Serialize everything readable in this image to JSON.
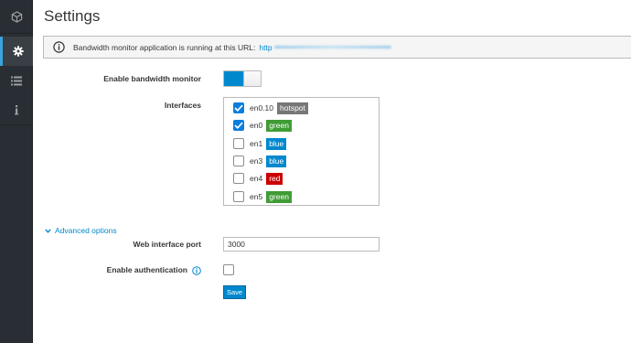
{
  "page": {
    "title": "Settings"
  },
  "sidebar": {
    "items": [
      {
        "icon": "cube-icon",
        "active": false
      },
      {
        "icon": "gear-icon",
        "active": true
      },
      {
        "icon": "list-icon",
        "active": false
      },
      {
        "icon": "info-icon",
        "active": false
      }
    ]
  },
  "alert": {
    "icon": "info-circle-icon",
    "message": "Bandwidth monitor application is running at this URL:",
    "url_prefix": "http"
  },
  "form": {
    "bandwidth_label": "Enable bandwidth monitor",
    "bandwidth_enabled": true,
    "interfaces_label": "Interfaces",
    "interfaces": [
      {
        "name": "en0.10",
        "checked": true,
        "badge": "hotspot",
        "badge_color": "#777777"
      },
      {
        "name": "en0",
        "checked": true,
        "badge": "green",
        "badge_color": "#3f9c35"
      },
      {
        "name": "en1",
        "checked": false,
        "badge": "blue",
        "badge_color": "#0088ce"
      },
      {
        "name": "en3",
        "checked": false,
        "badge": "blue",
        "badge_color": "#0088ce"
      },
      {
        "name": "en4",
        "checked": false,
        "badge": "red",
        "badge_color": "#cc0000"
      },
      {
        "name": "en5",
        "checked": false,
        "badge": "green",
        "badge_color": "#3f9c35"
      }
    ],
    "advanced_label": "Advanced options",
    "port_label": "Web interface port",
    "port_value": "3000",
    "auth_label": "Enable authentication",
    "auth_enabled": false,
    "save_label": "Save"
  },
  "colors": {
    "accent": "#0088ce",
    "sidebar_bg": "#292e34",
    "checkbox_checked": "#0a7ede"
  }
}
